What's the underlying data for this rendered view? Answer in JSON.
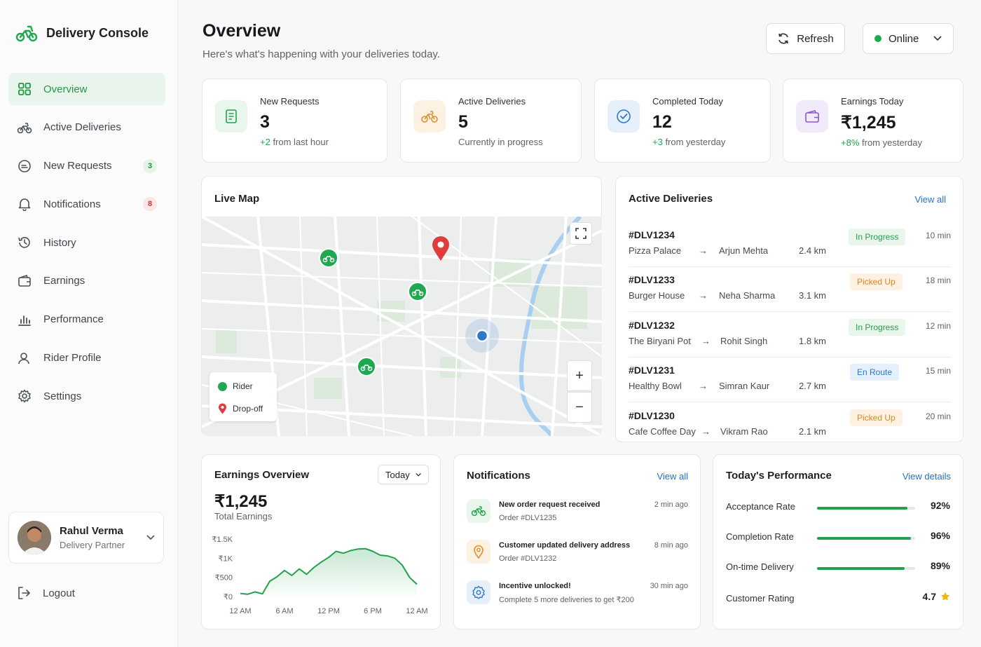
{
  "app": {
    "title": "Delivery Console"
  },
  "colors": {
    "brand": "#1fa84f",
    "accent_blue": "#1f6fd0",
    "badge_red": "#d92f2f"
  },
  "sidebar": {
    "items": [
      {
        "label": "Overview",
        "icon": "grid-icon",
        "active": true
      },
      {
        "label": "Active Deliveries",
        "icon": "bike-icon"
      },
      {
        "label": "New Requests",
        "icon": "request-icon",
        "badge": "3"
      },
      {
        "label": "Notifications",
        "icon": "bell-icon",
        "badge": "8"
      },
      {
        "label": "History",
        "icon": "history-icon"
      },
      {
        "label": "Earnings",
        "icon": "wallet-icon"
      },
      {
        "label": "Performance",
        "icon": "bar-chart-icon"
      },
      {
        "label": "Rider Profile",
        "icon": "user-icon"
      },
      {
        "label": "Settings",
        "icon": "gear-icon"
      }
    ],
    "profile": {
      "name": "Rahul Verma",
      "role": "Delivery Partner"
    },
    "logout": "Logout"
  },
  "header": {
    "title": "Overview",
    "subtitle": "Here's what's happening with your deliveries today.",
    "refresh": "Refresh",
    "status": "Online"
  },
  "stats": [
    {
      "label": "New Requests",
      "value": "3",
      "delta": "+2",
      "note": " from last hour"
    },
    {
      "label": "Active Deliveries",
      "value": "5",
      "delta": "",
      "note": "Currently in progress"
    },
    {
      "label": "Completed Today",
      "value": "12",
      "delta": "+3",
      "note": " from yesterday"
    },
    {
      "label": "Earnings Today",
      "value": "₹1,245",
      "delta": "+8%",
      "note": " from yesterday"
    }
  ],
  "map": {
    "title": "Live Map",
    "legend_rider": "Rider",
    "legend_dropoff": "Drop-off",
    "zoom_in": "+",
    "zoom_out": "−"
  },
  "active": {
    "title": "Active Deliveries",
    "view_all": "View all",
    "rows": [
      {
        "id": "#DLV1234",
        "from": "Pizza Palace",
        "to": "Arjun Mehta",
        "dist": "2.4 km",
        "status": "In Progress",
        "kind": "prog",
        "time": "10 min"
      },
      {
        "id": "#DLV1233",
        "from": "Burger House",
        "to": "Neha Sharma",
        "dist": "3.1 km",
        "status": "Picked Up",
        "kind": "pick",
        "time": "18 min"
      },
      {
        "id": "#DLV1232",
        "from": "The Biryani Pot",
        "to": "Rohit Singh",
        "dist": "1.8 km",
        "status": "In Progress",
        "kind": "prog",
        "time": "12 min"
      },
      {
        "id": "#DLV1231",
        "from": "Healthy Bowl",
        "to": "Simran Kaur",
        "dist": "2.7 km",
        "status": "En Route",
        "kind": "route",
        "time": "15 min"
      },
      {
        "id": "#DLV1230",
        "from": "Cafe Coffee Day",
        "to": "Vikram Rao",
        "dist": "2.1 km",
        "status": "Picked Up",
        "kind": "pick",
        "time": "20 min"
      }
    ]
  },
  "earnings": {
    "title": "Earnings Overview",
    "range": "Today",
    "total": "₹1,245",
    "total_label": "Total Earnings"
  },
  "chart_data": {
    "type": "area",
    "title": "",
    "xlabel": "",
    "ylabel": "",
    "x_ticks": [
      "12 AM",
      "6 AM",
      "12 PM",
      "6 PM",
      "12 AM"
    ],
    "y_ticks": [
      "₹0",
      "₹500",
      "₹1K",
      "₹1.5K"
    ],
    "ylim": [
      0,
      1500
    ],
    "x": [
      0,
      1,
      2,
      3,
      4,
      5,
      6,
      7,
      8,
      9,
      10,
      11,
      12,
      13,
      14,
      15,
      16,
      17,
      18,
      19,
      20,
      21,
      22,
      23,
      24
    ],
    "values": [
      80,
      60,
      120,
      70,
      400,
      520,
      680,
      550,
      720,
      580,
      760,
      900,
      1020,
      1180,
      1130,
      1200,
      1240,
      1250,
      1180,
      1080,
      1060,
      1000,
      820,
      500,
      320
    ]
  },
  "notifications": {
    "title": "Notifications",
    "view_all": "View all",
    "items": [
      {
        "title": "New order request received",
        "sub": "Order #DLV1235",
        "time": "2 min ago",
        "icon": "bike-icon"
      },
      {
        "title": "Customer updated delivery address",
        "sub": "Order #DLV1232",
        "time": "8 min ago",
        "icon": "location-icon"
      },
      {
        "title": "Incentive unlocked!",
        "sub": "Complete 5 more deliveries to get ₹200",
        "time": "30 min ago",
        "icon": "badge-icon"
      }
    ]
  },
  "performance": {
    "title": "Today's Performance",
    "view_details": "View details",
    "rows": [
      {
        "label": "Acceptance Rate",
        "value": "92%",
        "fraction": 0.92
      },
      {
        "label": "Completion Rate",
        "value": "96%",
        "fraction": 0.96
      },
      {
        "label": "On-time Delivery",
        "value": "89%",
        "fraction": 0.89
      }
    ],
    "rating_label": "Customer Rating",
    "rating_value": "4.7"
  }
}
